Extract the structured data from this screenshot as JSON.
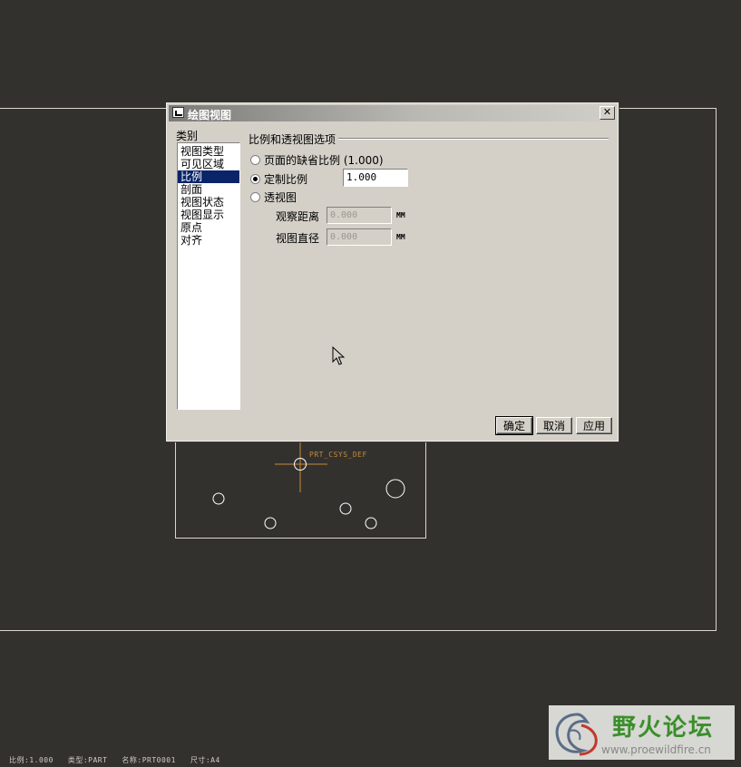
{
  "dialog": {
    "title": "绘图视图",
    "close_glyph": "✕",
    "category_label": "类别",
    "categories": [
      {
        "label": "视图类型",
        "selected": false
      },
      {
        "label": "可见区域",
        "selected": false
      },
      {
        "label": "比例",
        "selected": true
      },
      {
        "label": "剖面",
        "selected": false
      },
      {
        "label": "视图状态",
        "selected": false
      },
      {
        "label": "视图显示",
        "selected": false
      },
      {
        "label": "原点",
        "selected": false
      },
      {
        "label": "对齐",
        "selected": false
      }
    ],
    "group_title": "比例和透视图选项",
    "options": {
      "default_scale": {
        "label": "页面的缺省比例 (1.000)",
        "checked": false
      },
      "custom_scale": {
        "label": "定制比例",
        "checked": true,
        "value": "1.000"
      },
      "perspective": {
        "label": "透视图",
        "checked": false
      }
    },
    "fields": {
      "observe_distance": {
        "label": "观察距离",
        "value": "0.000",
        "unit": "MM"
      },
      "view_diameter": {
        "label": "视图直径",
        "value": "0.000",
        "unit": "MM"
      }
    },
    "buttons": {
      "ok": "确定",
      "cancel": "取消",
      "apply": "应用"
    }
  },
  "drawing": {
    "csys_label": "PRT_CSYS_DEF",
    "status_line": "比例:1.000   类型:PART   名称:PRT0001   尺寸:A4"
  },
  "watermark": {
    "title": "野火论坛",
    "url": "www.proewildfire.cn"
  },
  "colors": {
    "background": "#33312d",
    "selection": "#0a246a",
    "csys": "#c68a3c",
    "watermark_green": "#3a8f2a"
  }
}
